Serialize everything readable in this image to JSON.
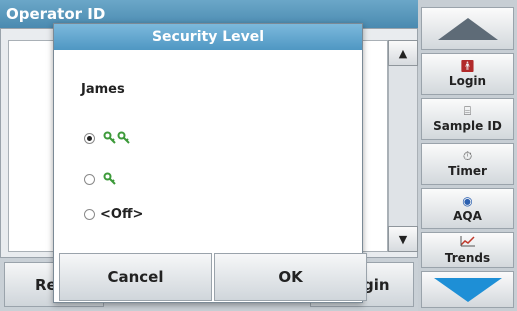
{
  "background": {
    "title": "Operator ID",
    "bottom_left_label": "Re",
    "bottom_right_label": "gin"
  },
  "sidebar": {
    "items": [
      {
        "label": "Login",
        "icon": "person-icon"
      },
      {
        "label": "Sample ID",
        "icon": "sample-vial-icon"
      },
      {
        "label": "Timer",
        "icon": "timer-icon"
      },
      {
        "label": "AQA",
        "icon": "aqa-icon"
      },
      {
        "label": "Trends",
        "icon": "trends-chart-icon"
      }
    ]
  },
  "dialog": {
    "title": "Security Level",
    "user_name": "James",
    "options": [
      {
        "label": "",
        "icon": "two-keys-icon",
        "selected": true
      },
      {
        "label": "",
        "icon": "one-key-icon",
        "selected": false
      },
      {
        "label": "<Off>",
        "icon": "",
        "selected": false
      }
    ],
    "cancel_label": "Cancel",
    "ok_label": "OK"
  },
  "colors": {
    "title_bar": "#5aa0c9",
    "key_green": "#3d9a3a",
    "down_arrow": "#1e8fd6"
  }
}
